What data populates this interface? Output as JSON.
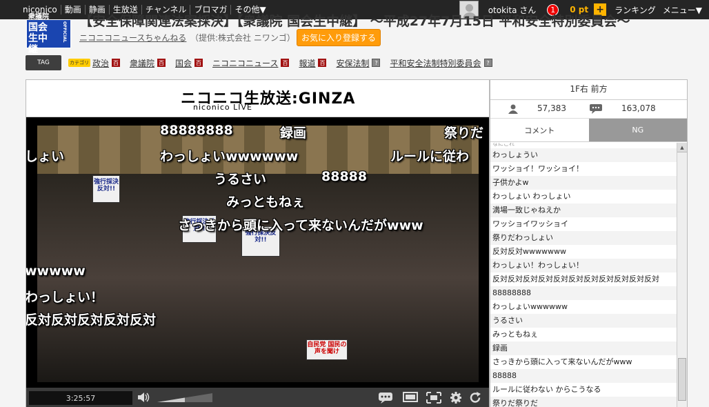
{
  "topbar": {
    "nav": [
      "niconico",
      "動画",
      "静画",
      "生放送",
      "チャンネル",
      "ブロマガ",
      "その他▼"
    ],
    "username": "otokita さん",
    "notifications": "1",
    "points": "0 pt",
    "plus": "+",
    "ranking": "ランキング",
    "menu": "メニュー▼"
  },
  "header": {
    "channel_logo": "国会生中継",
    "channel_logo_top": "衆議院",
    "official": "OFFICIAL",
    "title": "【安全保障関連法案採決】【衆議院 国会生中継】 ～平成27年7月15日 平和安全特別委員会～",
    "channel_name": "ニコニコニュースちゃんねる",
    "provider": "（提供:株式会社 ニワンゴ）",
    "fav_button": "お気に入り登録する"
  },
  "tags": {
    "label": "TAG",
    "category_badge": "カテゴリ",
    "items": [
      {
        "name": "政治",
        "icon": "dic"
      },
      {
        "name": "衆議院",
        "icon": "dic"
      },
      {
        "name": "国会",
        "icon": "dic"
      },
      {
        "name": "ニコニコニュース",
        "icon": "dic"
      },
      {
        "name": "報道",
        "icon": "dic"
      },
      {
        "name": "安保法制",
        "icon": "q"
      },
      {
        "name": "平和安全法制特別委員会",
        "icon": "q"
      }
    ],
    "dic_icon_text": "百",
    "q_icon_text": "?"
  },
  "player": {
    "logo": "ニコニコ生放送:GINZA",
    "logo_sub": "niconico LIVE",
    "time": "3:25:57",
    "signs": [
      "強行採決反対!!",
      "強行採決反対!!",
      "強行採決反対!!",
      "自民党 国民の声を聞け"
    ],
    "overlay_comments": [
      {
        "text": "88888888"
      },
      {
        "text": "録画"
      },
      {
        "text": "祭りだ"
      },
      {
        "text": "しょい"
      },
      {
        "text": "わっしょいwwwwww"
      },
      {
        "text": "ルールに従わ"
      },
      {
        "text": "うるさい"
      },
      {
        "text": "88888"
      },
      {
        "text": "みっともねぇ"
      },
      {
        "text": "さっきから頭に入って来ないんだがwww"
      },
      {
        "text": "wwwww"
      },
      {
        "text": "わっしょい！"
      },
      {
        "text": "反対反対反対反対反対"
      }
    ]
  },
  "sidebar": {
    "seat": "1F右 前方",
    "viewers": "57,383",
    "comments": "163,078",
    "tab_comment": "コメント",
    "tab_ng": "NG",
    "comments_list": [
      "なにこれ",
      "わっしょうい",
      "ワッショイ！ワッショイ！",
      "子供かよw",
      "わっしょい わっしょい",
      "満場一致じゃねえか",
      "ワッショイワッショイ",
      "祭りだわっしょい",
      "反対反対wwwwwww",
      "わっしょい！わっしょい！",
      "反対反対反対反対反対反対反対反対反対反対反対",
      "88888888",
      "わっしょいwwwwww",
      "うるさい",
      "みっともねぇ",
      "録画",
      "さっきから頭に入って来ないんだがwww",
      "88888",
      "ルールに従わない からこうなる",
      "祭りだ祭りだ"
    ]
  },
  "colors": {
    "accent": "#ff9c0b",
    "topbar": "#252525",
    "channel_blue": "#1a45b0"
  }
}
